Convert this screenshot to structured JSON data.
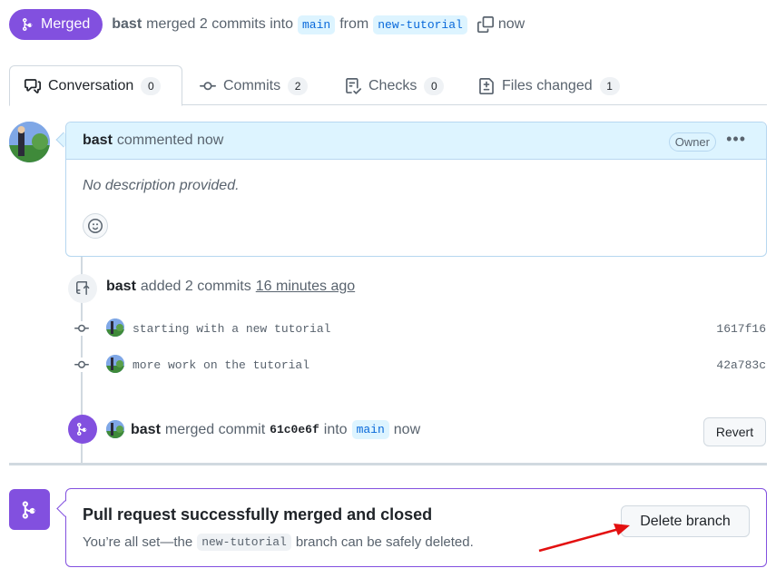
{
  "header": {
    "status": "Merged",
    "author": "bast",
    "action": "merged 2 commits into",
    "base_branch": "main",
    "from_word": "from",
    "head_branch": "new-tutorial",
    "time": "now"
  },
  "tabs": [
    {
      "label": "Conversation",
      "count": "0"
    },
    {
      "label": "Commits",
      "count": "2"
    },
    {
      "label": "Checks",
      "count": "0"
    },
    {
      "label": "Files changed",
      "count": "1"
    }
  ],
  "comment": {
    "author": "bast",
    "action": "commented now",
    "role": "Owner",
    "body": "No description provided."
  },
  "commits_event": {
    "author": "bast",
    "action": "added 2 commits",
    "time": "16 minutes ago",
    "commits": [
      {
        "message": "starting with a new tutorial",
        "sha": "1617f16"
      },
      {
        "message": "more work on the tutorial",
        "sha": "42a783c"
      }
    ]
  },
  "merge_event": {
    "author": "bast",
    "action": "merged commit",
    "sha": "61c0e6f",
    "into": "into",
    "branch": "main",
    "time": "now",
    "revert_label": "Revert"
  },
  "merged_box": {
    "title": "Pull request successfully merged and closed",
    "sub_prefix": "You’re all set—the",
    "branch": "new-tutorial",
    "sub_suffix": "branch can be safely deleted.",
    "delete_label": "Delete branch"
  },
  "colors": {
    "accent_purple": "#8250df",
    "annotation_arrow": "#e31010"
  }
}
